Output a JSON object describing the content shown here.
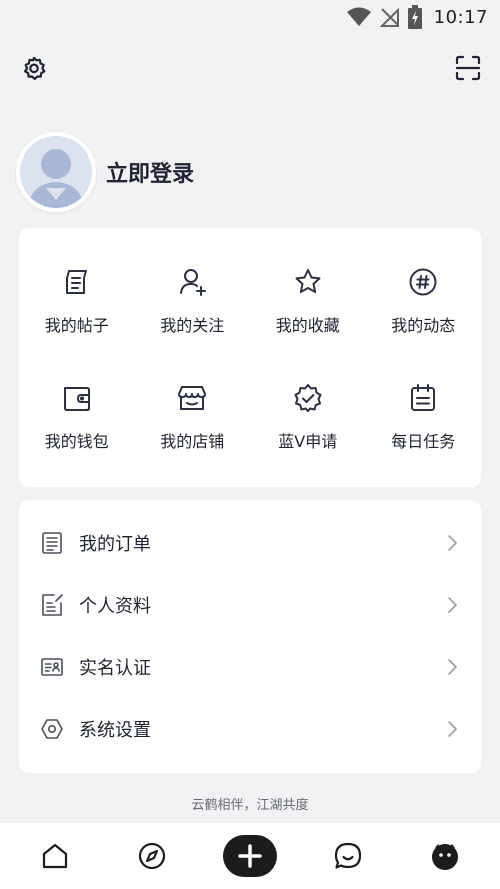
{
  "status_bar": {
    "time": "10:17",
    "icons": [
      "wifi-icon",
      "no-signal-icon",
      "battery-charging-icon"
    ]
  },
  "top_actions": {
    "settings_icon": "gear-icon",
    "scan_icon": "scan-icon"
  },
  "profile": {
    "login_label": "立即登录",
    "avatar_icon": "default-avatar-icon"
  },
  "quick_grid": {
    "items": [
      {
        "label": "我的帖子",
        "icon": "post-icon"
      },
      {
        "label": "我的关注",
        "icon": "follow-user-icon"
      },
      {
        "label": "我的收藏",
        "icon": "star-icon"
      },
      {
        "label": "我的动态",
        "icon": "hashtag-icon"
      },
      {
        "label": "我的钱包",
        "icon": "wallet-icon"
      },
      {
        "label": "我的店铺",
        "icon": "store-icon"
      },
      {
        "label": "蓝V申请",
        "icon": "verified-badge-icon"
      },
      {
        "label": "每日任务",
        "icon": "task-calendar-icon"
      }
    ]
  },
  "menu_list": {
    "items": [
      {
        "label": "我的订单",
        "icon": "order-list-icon"
      },
      {
        "label": "个人资料",
        "icon": "edit-profile-icon"
      },
      {
        "label": "实名认证",
        "icon": "id-card-icon"
      },
      {
        "label": "系统设置",
        "icon": "hexagon-settings-icon"
      }
    ]
  },
  "footer": {
    "slogan": "云鹤相伴，江湖共度"
  },
  "bottom_nav": {
    "items": [
      "home-icon",
      "compass-icon",
      "plus-icon",
      "message-icon",
      "profile-face-icon"
    ]
  },
  "colors": {
    "page_background": "#f2f2f4",
    "card_background": "#ffffff",
    "text_primary": "#1f2333",
    "icon_stroke": "#2b3045",
    "publish_button": "#1c1c1c"
  }
}
